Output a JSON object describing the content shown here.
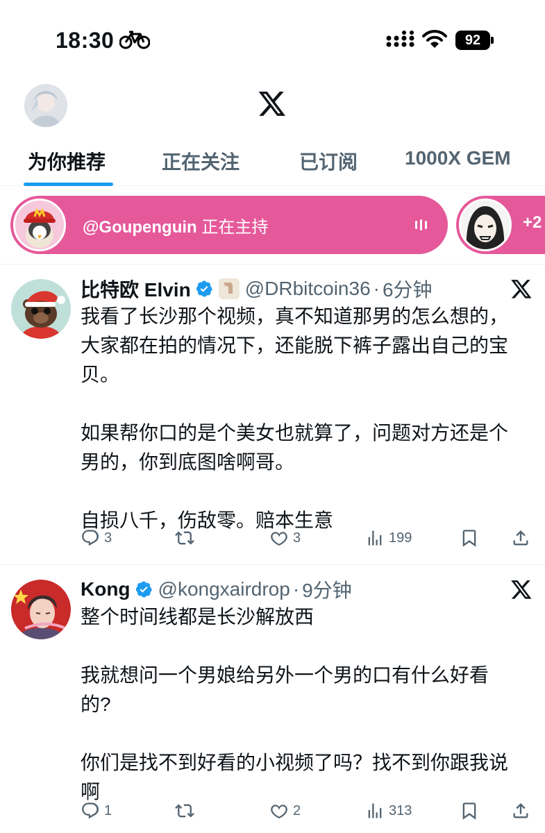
{
  "status_bar": {
    "time": "18:30",
    "battery": "92"
  },
  "tabs": [
    {
      "label": "为你推荐"
    },
    {
      "label": "正在关注"
    },
    {
      "label": "已订阅"
    },
    {
      "label": "1000X GEM"
    }
  ],
  "space": {
    "host": "@Goupenguin",
    "status": "正在主持",
    "extra_count": "+2"
  },
  "tweets": [
    {
      "name": "比特欧 Elvin",
      "handle": "@DRbitcoin36",
      "dot": "·",
      "time": "6分钟",
      "text": "我看了长沙那个视频，真不知道那男的怎么想的，\n大家都在拍的情况下，还能脱下裤子露出自己的宝\n贝。\n\n如果帮你口的是个美女也就算了，问题对方还是个\n男的，你到底图啥啊哥。\n\n自损八千，伤敌零。赔本生意",
      "replies": "3",
      "retweets": "",
      "likes": "3",
      "views": "199"
    },
    {
      "name": "Kong",
      "handle": "@kongxairdrop",
      "dot": "·",
      "time": "9分钟",
      "text": "整个时间线都是长沙解放西\n\n我就想问一个男娘给另外一个男的口有什么好看\n的?\n\n你们是找不到好看的小视频了吗？找不到你跟我说\n啊",
      "replies": "1",
      "retweets": "",
      "likes": "2",
      "views": "313"
    }
  ],
  "colors": {
    "accent": "#1d9bf0",
    "space_pink": "#e5589a",
    "muted": "#536471"
  }
}
